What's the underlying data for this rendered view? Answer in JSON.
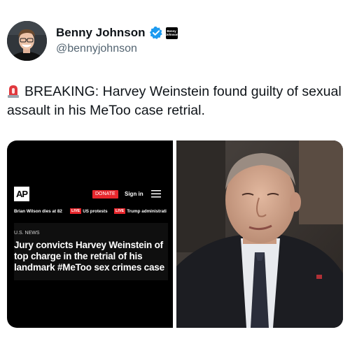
{
  "author": {
    "display_name": "Benny Johnson",
    "handle": "@bennyjohnson",
    "verified": true,
    "affiliate_badge_text": "Benny Johnson",
    "avatar": "avatar-photo"
  },
  "tweet": {
    "emoji": "rotating-light-siren-icon",
    "text": "BREAKING: Harvey Weinstein found guilty of sexual assault in his MeToo case retrial."
  },
  "media_left": {
    "logo": "AP",
    "donate_label": "DONATE",
    "signin_label": "Sign in",
    "ticker": {
      "item1": "Brian Wilson dies at 82",
      "live1": "LIVE",
      "item2": "US protests",
      "live2": "LIVE",
      "item3": "Trump administrati"
    },
    "section": "U.S. NEWS",
    "headline": "Jury convicts Harvey Weinstein of top charge in the retrial of his landmark #MeToo sex crimes case"
  },
  "media_right": {
    "photo": "courtroom-photo"
  },
  "colors": {
    "text": "#0f1419",
    "muted": "#536471",
    "verified_blue": "#1d9bf0",
    "ap_red": "#e8262c"
  }
}
